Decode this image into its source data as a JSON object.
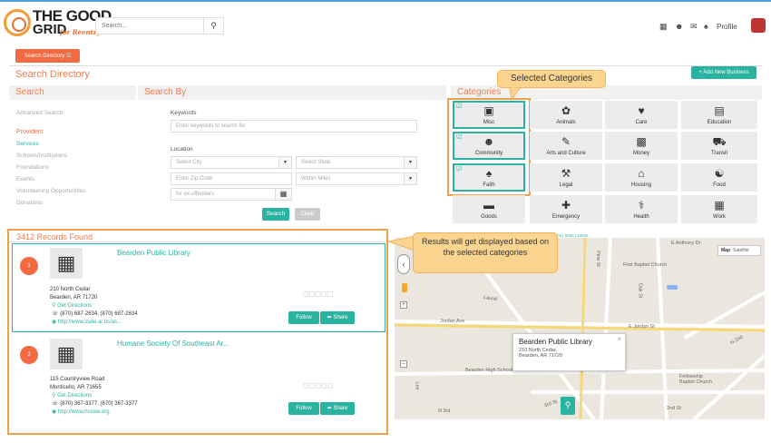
{
  "header": {
    "logo_line1": "THE GOOD",
    "logo_line2": "GRID",
    "logo_sub": "for Reentry",
    "search_placeholder": "Search...",
    "search_icon": "magnifier",
    "icons": [
      "grid-icon",
      "users-icon",
      "envelope-icon",
      "bell-icon"
    ],
    "profile_label": "Profile"
  },
  "toolbar": {
    "directory_button": "Search Directory",
    "page_title": "Search Directory",
    "add_business": "+ Add New Business"
  },
  "search_panel": {
    "heading": "Search",
    "links": [
      "Advanced Search",
      "Providers",
      "Services",
      "Schools/Institutions",
      "Foundations",
      "Events",
      "Volunteering Opportunities",
      "Donations"
    ],
    "active_link": "Providers"
  },
  "search_by": {
    "heading": "Search By",
    "keywords_label": "Keywords",
    "keywords_placeholder": "Enter keywords to search for",
    "location_label": "Location",
    "city_placeholder": "Select City",
    "state_placeholder": "Select State",
    "zip_placeholder": "Enter Zip Code",
    "within_placeholder": "Within Miles",
    "offenders_placeholder": "for ex-offenders",
    "search_button": "Search",
    "clear_button": "Clear"
  },
  "categories": {
    "heading": "Categories",
    "items": [
      {
        "label": "Misc",
        "icon": "box",
        "selected": true
      },
      {
        "label": "Animals",
        "icon": "paw",
        "selected": false
      },
      {
        "label": "Care",
        "icon": "heart",
        "selected": false
      },
      {
        "label": "Education",
        "icon": "book",
        "selected": false
      },
      {
        "label": "Community",
        "icon": "users",
        "selected": true
      },
      {
        "label": "Arts and Culture",
        "icon": "brush",
        "selected": false
      },
      {
        "label": "Money",
        "icon": "money",
        "selected": false
      },
      {
        "label": "Transit",
        "icon": "car",
        "selected": false
      },
      {
        "label": "Faith",
        "icon": "bell",
        "selected": true
      },
      {
        "label": "Legal",
        "icon": "gavel",
        "selected": false
      },
      {
        "label": "Housing",
        "icon": "home",
        "selected": false
      },
      {
        "label": "Food",
        "icon": "cutlery",
        "selected": false
      },
      {
        "label": "Goods",
        "icon": "inbox",
        "selected": false
      },
      {
        "label": "Emergency",
        "icon": "ambulance",
        "selected": false
      },
      {
        "label": "Health",
        "icon": "stethoscope",
        "selected": false
      },
      {
        "label": "Work",
        "icon": "building",
        "selected": false
      }
    ]
  },
  "annotations": {
    "selected_categories": "Selected Categories",
    "results_note": "Results will get displayed based on the selected categories"
  },
  "results": {
    "count_text": "3412 Records Found",
    "records": [
      {
        "index": "1",
        "name": "Bearden Public Library",
        "street": "210 North Cedar",
        "city": "Bearden, AR 71720",
        "directions": "Get Directions",
        "phone": "(870) 687-2634, (870) 687-2634",
        "url": "http://www.state.ar.us/as...",
        "follow": "Follow",
        "share": "Share"
      },
      {
        "index": "2",
        "name": "Humane Society Of Southeast Ar...",
        "street": "115 Countryview Road",
        "city": "Monticello, AR 71655",
        "directions": "Get Directions",
        "phone": "(870) 367-3377, (870) 367-3377",
        "url": "http://www.hsswa.org",
        "follow": "Follow",
        "share": "Share"
      }
    ]
  },
  "map": {
    "radius_text": "Display locations near me: 1mi | 5mi | 10mi | 20mi | 50mi | 100mi",
    "map_button": "Map",
    "satellite_button": "Satellite",
    "popup_title": "Bearden Public Library",
    "popup_line1": "210 North Cedar,",
    "popup_line2": "Bearden, AR 71720",
    "streets": [
      "E Anthony Dr",
      "First Baptist Church",
      "Pine St",
      "Oak St",
      "Laurel",
      "Jordan Ave",
      "E Jordan St",
      "Bearden High School",
      "Fellowship Baptist Church",
      "N 2nd",
      "N 3rd",
      "3rd St",
      "2nd St",
      "Lee"
    ]
  }
}
